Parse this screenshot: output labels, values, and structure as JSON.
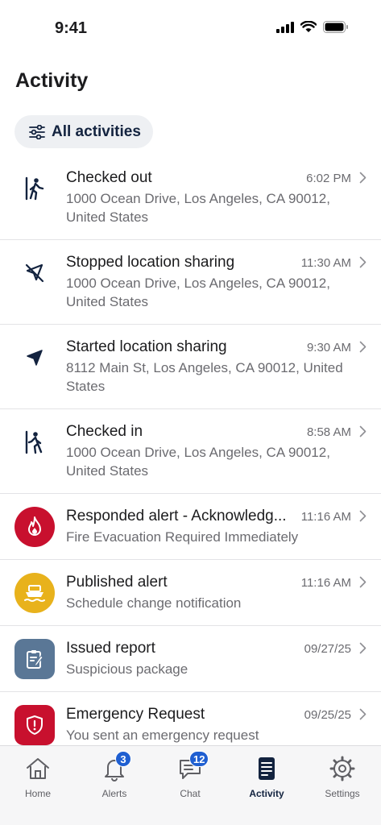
{
  "status_bar": {
    "time": "9:41"
  },
  "page": {
    "title": "Activity"
  },
  "filter": {
    "label": "All activities",
    "icon": "sliders-icon"
  },
  "activities": [
    {
      "title": "Checked out",
      "time": "6:02 PM",
      "subtitle": "1000 Ocean Drive, Los Angeles, CA 90012, United States",
      "icon": "walk-out-icon"
    },
    {
      "title": "Stopped location sharing",
      "time": "11:30 AM",
      "subtitle": "1000 Ocean Drive, Los Angeles, CA 90012, United States",
      "icon": "location-off-icon"
    },
    {
      "title": "Started location sharing",
      "time": "9:30 AM",
      "subtitle": "8112 Main St, Los Angeles, CA 90012, United States",
      "icon": "location-arrow-icon"
    },
    {
      "title": "Checked in",
      "time": "8:58 AM",
      "subtitle": "1000 Ocean Drive, Los Angeles, CA 90012, United States",
      "icon": "walk-in-icon"
    },
    {
      "title": "Responded alert - Acknowledg...",
      "time": "11:16 AM",
      "subtitle": "Fire Evacuation Required Immediately",
      "icon": "fire-icon",
      "color": "#c8102e"
    },
    {
      "title": "Published alert",
      "time": "11:16 AM",
      "subtitle": "Schedule change notification",
      "icon": "ferry-icon",
      "color": "#e8b21c"
    },
    {
      "title": "Issued report",
      "time": "09/27/25",
      "subtitle": "Suspicious package",
      "icon": "clipboard-edit-icon",
      "color": "#5a7796"
    },
    {
      "title": "Emergency Request",
      "time": "09/25/25",
      "subtitle": "You sent an emergency request",
      "icon": "shield-alert-icon",
      "color": "#c8102e"
    }
  ],
  "tabs": [
    {
      "label": "Home",
      "icon": "home-icon"
    },
    {
      "label": "Alerts",
      "icon": "bell-icon",
      "badge": "3"
    },
    {
      "label": "Chat",
      "icon": "chat-icon",
      "badge": "12"
    },
    {
      "label": "Activity",
      "icon": "activity-list-icon",
      "active": true
    },
    {
      "label": "Settings",
      "icon": "settings-icon"
    }
  ],
  "colors": {
    "brand_navy": "#13233f",
    "badge_blue": "#1f5fd1"
  }
}
